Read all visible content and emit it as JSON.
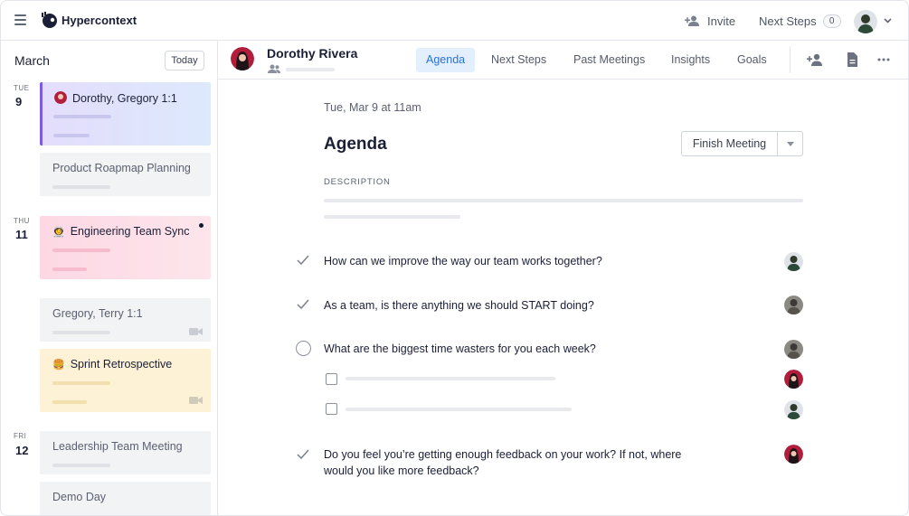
{
  "app": {
    "brand": "Hypercontext",
    "invite_label": "Invite",
    "next_steps_label": "Next Steps",
    "next_steps_count": "0"
  },
  "sidebar": {
    "month": "March",
    "today_label": "Today",
    "days": [
      {
        "weekday": "TUE",
        "day": "9"
      },
      {
        "weekday": "THU",
        "day": "11"
      },
      {
        "weekday": "FRI",
        "day": "12"
      }
    ],
    "meetings": [
      {
        "title": "Dorothy, Gregory 1:1"
      },
      {
        "title": "Product Roapmap Planning"
      },
      {
        "title": "Engineering Team Sync",
        "emoji": "👩‍🚀"
      },
      {
        "title": "Gregory, Terry 1:1"
      },
      {
        "title": "Sprint Retrospective",
        "emoji": "🍔"
      },
      {
        "title": "Leadership Team Meeting"
      },
      {
        "title": "Demo Day"
      }
    ]
  },
  "header": {
    "name": "Dorothy Rivera",
    "tabs": [
      "Agenda",
      "Next Steps",
      "Past Meetings",
      "Insights",
      "Goals"
    ],
    "active_tab": "Agenda"
  },
  "main": {
    "date": "Tue, Mar 9 at 11am",
    "title": "Agenda",
    "finish_label": "Finish Meeting",
    "description_label": "DESCRIPTION",
    "items": [
      {
        "text": "How can we improve the way our team works together?",
        "done": true
      },
      {
        "text": "As a team, is there anything we should START doing?",
        "done": true
      },
      {
        "text": "What are the biggest time wasters for you each week?",
        "done": false
      },
      {
        "text": "Do you feel you’re getting enough feedback on your work? If not, where would you like more feedback?",
        "done": true
      }
    ]
  },
  "colors": {
    "accent": "#2a72d6",
    "active_tab_bg": "#e4effd",
    "card_selected": "#dfe6fd",
    "card_pink": "#fde2ea",
    "card_yellow": "#fdf1d6",
    "card_gray": "#f2f3f5"
  }
}
